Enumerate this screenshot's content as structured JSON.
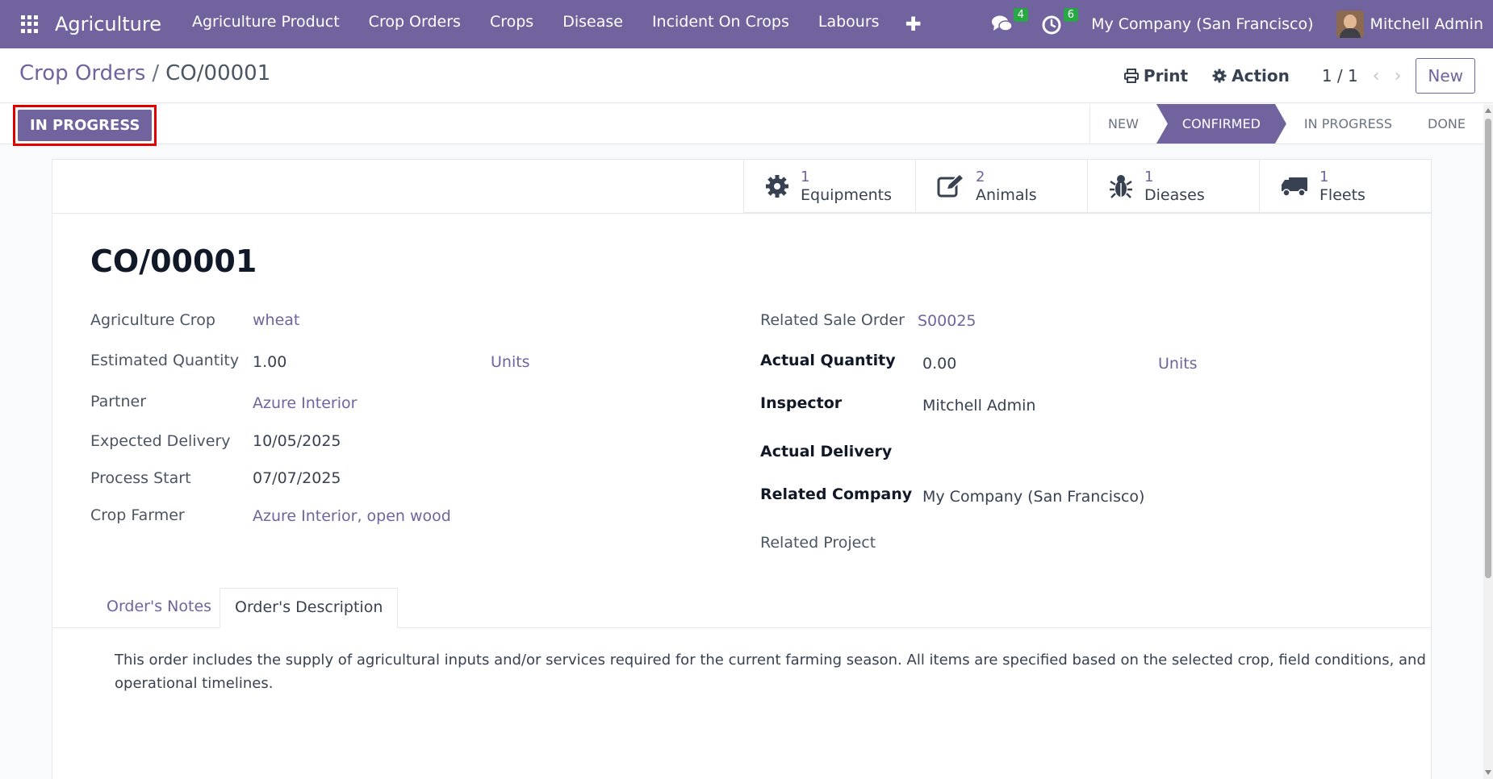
{
  "navbar": {
    "brand": "Agriculture",
    "menu": [
      "Agriculture Product",
      "Crop Orders",
      "Crops",
      "Disease",
      "Incident On Crops",
      "Labours"
    ],
    "messages_badge": "4",
    "activities_badge": "6",
    "company": "My Company (San Francisco)",
    "user": "Mitchell Admin"
  },
  "control": {
    "breadcrumb_parent": "Crop Orders",
    "breadcrumb_separator": "/",
    "breadcrumb_current": "CO/00001",
    "print_label": "Print",
    "action_label": "Action",
    "pager": "1 / 1",
    "new_label": "New"
  },
  "statusbar": {
    "action_button": "IN PROGRESS",
    "stages": [
      "NEW",
      "CONFIRMED",
      "IN PROGRESS",
      "DONE"
    ],
    "active_stage": "CONFIRMED"
  },
  "smart_buttons": [
    {
      "value": "1",
      "label": "Equipments",
      "icon": "gear-icon"
    },
    {
      "value": "2",
      "label": "Animals",
      "icon": "edit-icon"
    },
    {
      "value": "1",
      "label": "Dieases",
      "icon": "bug-icon"
    },
    {
      "value": "1",
      "label": "Fleets",
      "icon": "truck-icon"
    }
  ],
  "form": {
    "title": "CO/00001",
    "left": {
      "crop_label": "Agriculture Crop",
      "crop_value": "wheat",
      "est_qty_label": "Estimated Quantity",
      "est_qty_value": "1.00",
      "est_qty_uom": "Units",
      "partner_label": "Partner",
      "partner_value": "Azure Interior",
      "exp_delivery_label": "Expected Delivery",
      "exp_delivery_value": "10/05/2025",
      "process_start_label": "Process Start",
      "process_start_value": "07/07/2025",
      "farmer_label": "Crop Farmer",
      "farmer_value": "Azure Interior, open wood"
    },
    "right": {
      "sale_order_label": "Related Sale Order",
      "sale_order_value": "S00025",
      "actual_qty_label": "Actual Quantity",
      "actual_qty_value": "0.00",
      "actual_qty_uom": "Units",
      "inspector_label": "Inspector",
      "inspector_value": "Mitchell Admin",
      "actual_delivery_label": "Actual Delivery",
      "company_label": "Related Company",
      "company_value": "My Company (San Francisco)",
      "project_label": "Related Project"
    }
  },
  "tabs": {
    "notes": "Order's Notes",
    "description": "Order's Description",
    "active": "Order's Description",
    "description_text": "This order includes the supply of agricultural inputs and/or services required for the current farming season. All items are specified based on the selected crop, field conditions, and operational timelines."
  },
  "colors": {
    "brand": "#71639e",
    "badge": "#28a745",
    "highlight": "#e00000"
  }
}
